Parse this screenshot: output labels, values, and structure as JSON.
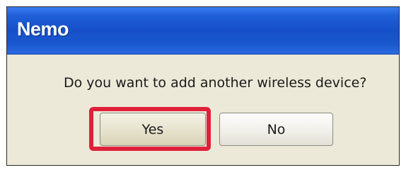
{
  "dialog": {
    "title": "Nemo",
    "message": "Do you want to add another wireless device?",
    "buttons": {
      "yes_label": "Yes",
      "no_label": "No"
    }
  },
  "colors": {
    "titlebar": "#1f5fd8",
    "dialog_background": "#ece9d8",
    "highlight": "#e0203a"
  }
}
